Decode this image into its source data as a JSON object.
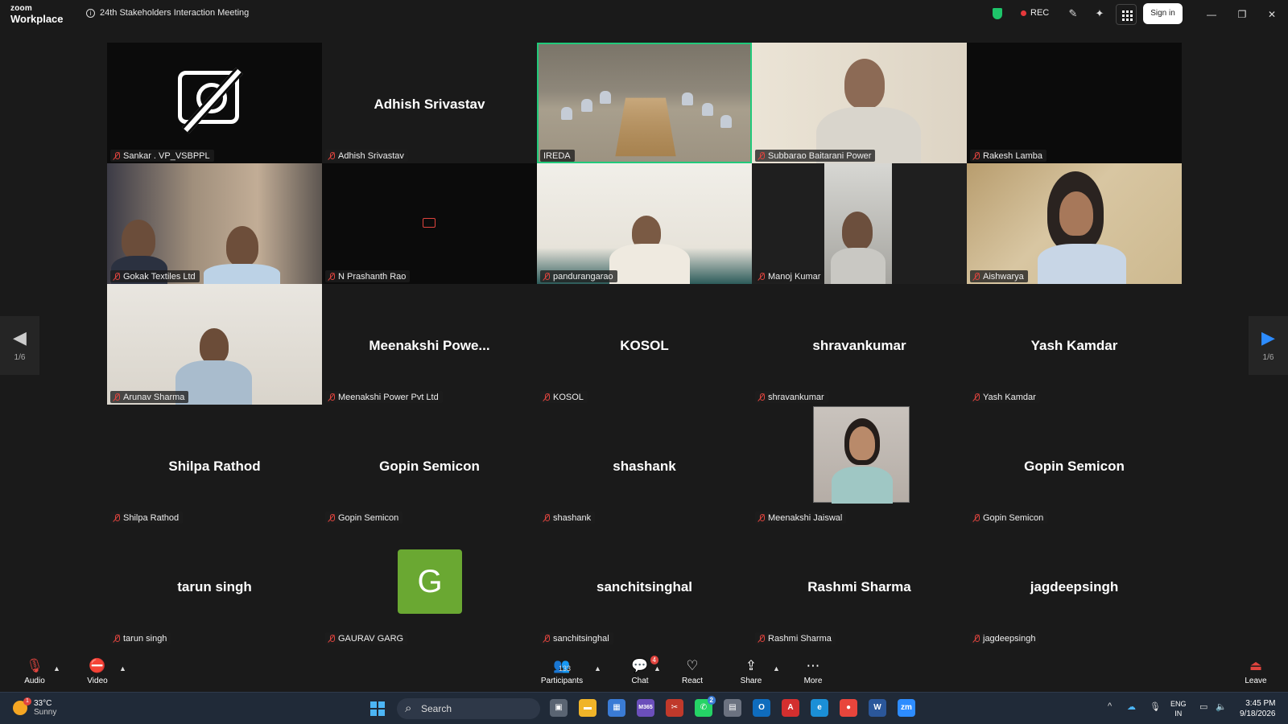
{
  "window": {
    "logo_line1": "zoom",
    "logo_line2": "Workplace",
    "meeting_title": "24th Stakeholders Interaction Meeting",
    "rec_label": "REC",
    "signin_label": "Sign in"
  },
  "gallery": {
    "tiles": [
      {
        "display": "",
        "tag": "Sankar . VP_VSBPPL"
      },
      {
        "display": "Adhish Srivastav",
        "tag": "Adhish Srivastav"
      },
      {
        "display": "",
        "tag": "IREDA"
      },
      {
        "display": "",
        "tag": "Subbarao Baitarani Power"
      },
      {
        "display": "",
        "tag": "Rakesh Lamba"
      },
      {
        "display": "",
        "tag": "Gokak Textiles Ltd"
      },
      {
        "display": "",
        "tag": "N Prashanth Rao"
      },
      {
        "display": "",
        "tag": "pandurangarao"
      },
      {
        "display": "",
        "tag": "Manoj Kumar"
      },
      {
        "display": "",
        "tag": "Aishwarya"
      },
      {
        "display": "",
        "tag": "Arunav Sharma"
      },
      {
        "display": "Meenakshi  Powe...",
        "tag": "Meenakshi Power Pvt Ltd"
      },
      {
        "display": "KOSOL",
        "tag": "KOSOL"
      },
      {
        "display": "shravankumar",
        "tag": "shravankumar"
      },
      {
        "display": "Yash Kamdar",
        "tag": "Yash Kamdar"
      },
      {
        "display": "Shilpa Rathod",
        "tag": "Shilpa Rathod"
      },
      {
        "display": "Gopin Semicon",
        "tag": "Gopin Semicon"
      },
      {
        "display": "shashank",
        "tag": "shashank"
      },
      {
        "display": "",
        "tag": "Meenakshi Jaiswal"
      },
      {
        "display": "Gopin Semicon",
        "tag": "Gopin Semicon"
      },
      {
        "display": "tarun singh",
        "tag": "tarun singh"
      },
      {
        "display": "G",
        "tag": "GAURAV GARG"
      },
      {
        "display": "sanchitsinghal",
        "tag": "sanchitsinghal"
      },
      {
        "display": "Rashmi Sharma",
        "tag": "Rashmi Sharma"
      },
      {
        "display": "jagdeepsingh",
        "tag": "jagdeepsingh"
      }
    ],
    "page_left": "1/6",
    "page_right": "1/6",
    "active_speaker_color": "#21c97a",
    "avatar_color": "#6aa832"
  },
  "controls": {
    "audio": "Audio",
    "video": "Video",
    "participants": "Participants",
    "participants_count": "133",
    "chat": "Chat",
    "chat_badge": "4",
    "react": "React",
    "share": "Share",
    "more": "More",
    "leave": "Leave"
  },
  "taskbar": {
    "temp": "33°C",
    "condition": "Sunny",
    "weather_badge": "1",
    "search_label": "Search",
    "lang_line1": "ENG",
    "lang_line2": "IN",
    "time": "3:45 PM",
    "date": "9/18/2026",
    "whatsapp_badge": "2",
    "app_m365": "M365"
  }
}
